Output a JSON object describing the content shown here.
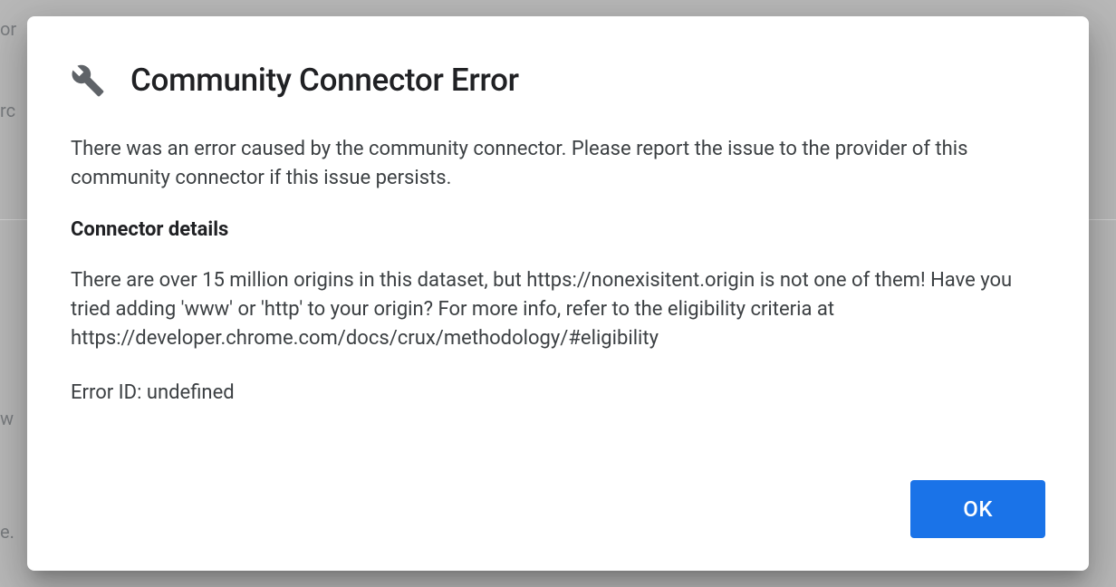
{
  "dialog": {
    "title": "Community Connector Error",
    "intro": "There was an error caused by the community connector. Please report the issue to the provider of this community connector if this issue persists.",
    "details_heading": "Connector details",
    "details_body": "There are over 15 million origins in this dataset, but https://nonexisitent.origin is not one of them! Have you tried adding 'www' or 'http' to your origin? For more info, refer to the eligibility criteria at https://developer.chrome.com/docs/crux/methodology/#eligibility",
    "error_id_label": "Error ID: ",
    "error_id_value": "undefined",
    "ok_label": "OK"
  },
  "background": {
    "t1": "or",
    "t2": "rc",
    "t3": "w",
    "t4": "e."
  }
}
